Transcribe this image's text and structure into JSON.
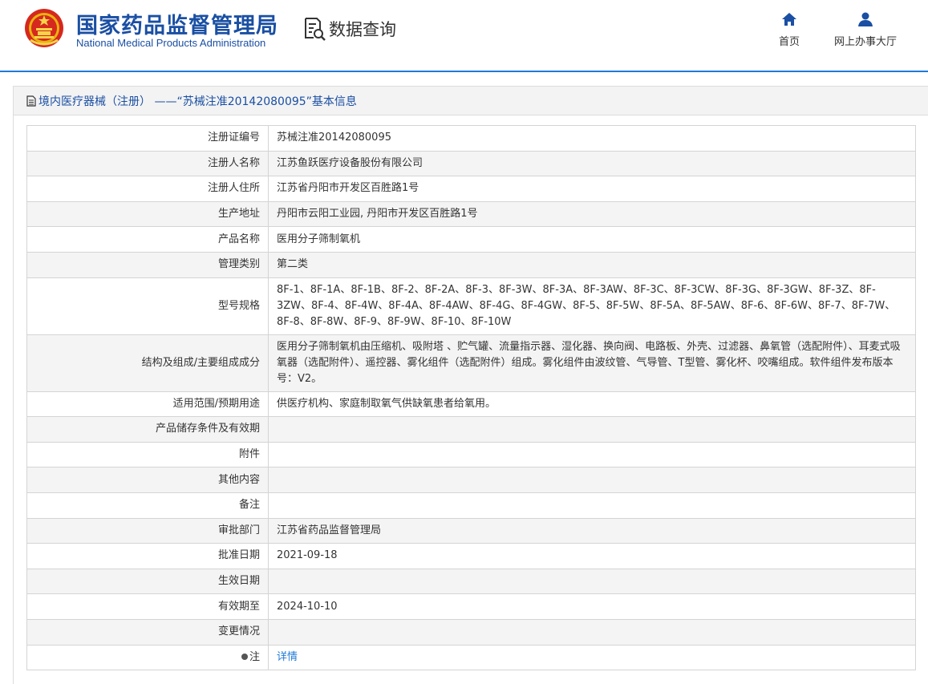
{
  "header": {
    "org_name_cn": "国家药品监督管理局",
    "org_name_en": "National Medical Products Administration",
    "query_label": "数据查询",
    "nav": [
      {
        "label": "首页",
        "icon": "home-icon"
      },
      {
        "label": "网上办事大厅",
        "icon": "user-icon"
      }
    ]
  },
  "panel": {
    "title": "境内医疗器械（注册） ——“苏械注准20142080095”基本信息"
  },
  "rows": [
    {
      "label": "注册证编号",
      "value": "苏械注准20142080095"
    },
    {
      "label": "注册人名称",
      "value": "江苏鱼跃医疗设备股份有限公司"
    },
    {
      "label": "注册人住所",
      "value": "江苏省丹阳市开发区百胜路1号"
    },
    {
      "label": "生产地址",
      "value": "丹阳市云阳工业园, 丹阳市开发区百胜路1号"
    },
    {
      "label": "产品名称",
      "value": "医用分子筛制氧机"
    },
    {
      "label": "管理类别",
      "value": "第二类"
    },
    {
      "label": "型号规格",
      "value": "8F-1、8F-1A、8F-1B、8F-2、8F-2A、8F-3、8F-3W、8F-3A、8F-3AW、8F-3C、8F-3CW、8F-3G、8F-3GW、8F-3Z、8F-3ZW、8F-4、8F-4W、8F-4A、8F-4AW、8F-4G、8F-4GW、8F-5、8F-5W、8F-5A、8F-5AW、8F-6、8F-6W、8F-7、8F-7W、8F-8、8F-8W、8F-9、8F-9W、8F-10、8F-10W"
    },
    {
      "label": "结构及组成/主要组成成分",
      "value": "医用分子筛制氧机由压缩机、吸附塔 、贮气罐、流量指示器、湿化器、换向阀、电路板、外壳、过滤器、鼻氧管（选配附件）、耳麦式吸氧器（选配附件）、遥控器、雾化组件（选配附件）组成。雾化组件由波纹管、气导管、T型管、雾化杯、咬嘴组成。软件组件发布版本号：V2。"
    },
    {
      "label": "适用范围/预期用途",
      "value": "供医疗机构、家庭制取氧气供缺氧患者给氧用。"
    },
    {
      "label": "产品储存条件及有效期",
      "value": ""
    },
    {
      "label": "附件",
      "value": ""
    },
    {
      "label": "其他内容",
      "value": ""
    },
    {
      "label": "备注",
      "value": ""
    },
    {
      "label": "审批部门",
      "value": "江苏省药品监督管理局"
    },
    {
      "label": "批准日期",
      "value": "2021-09-18"
    },
    {
      "label": "生效日期",
      "value": ""
    },
    {
      "label": "有效期至",
      "value": "2024-10-10"
    },
    {
      "label": "变更情况",
      "value": ""
    }
  ],
  "note_row": {
    "label": "注",
    "link_text": "详情"
  }
}
